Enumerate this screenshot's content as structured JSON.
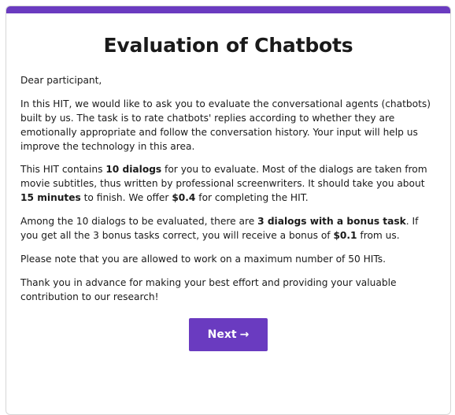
{
  "title": "Evaluation of Chatbots",
  "greeting": "Dear participant,",
  "intro": "In this HIT, we would like to ask you to evaluate the conversational agents (chatbots) built by us. The task is to rate chatbots' replies according to whether they are emotionally appropriate and follow the conversation history. Your input will help us improve the technology in this area.",
  "details": {
    "t1": "This HIT contains ",
    "dialogs": "10 dialogs",
    "t2": " for you to evaluate. Most of the dialogs are taken from movie subtitles, thus written by professional screenwriters. It should take you about ",
    "minutes": "15 minutes",
    "t3": " to finish. We offer ",
    "pay": "$0.4",
    "t4": " for completing the HIT."
  },
  "bonus": {
    "t1": "Among the 10 dialogs to be evaluated, there are ",
    "bonus_dialogs": "3 dialogs with a bonus task",
    "t2": ". If you get all the 3 bonus tasks correct, you will receive a bonus of ",
    "bonus_pay": "$0.1",
    "t3": " from us."
  },
  "limit": "Please note that you are allowed to work on a maximum number of 50 HITs.",
  "thanks": "Thank you in advance for making your best effort and providing your valuable contribution to our research!",
  "next_button": {
    "label": "Next",
    "arrow": "→"
  },
  "colors": {
    "accent": "#6a3bc0"
  }
}
